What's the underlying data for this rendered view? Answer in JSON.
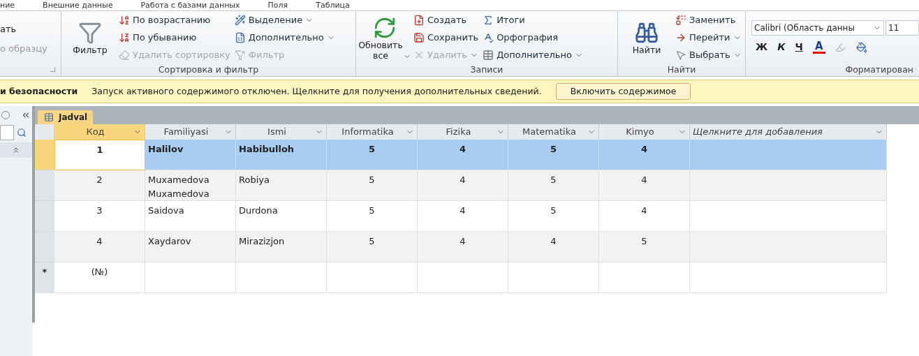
{
  "ribbon_tabs": [
    {
      "label": "ние"
    },
    {
      "label": "Внешние данные"
    },
    {
      "label": "Работа с базами данных"
    },
    {
      "label": "Поля"
    },
    {
      "label": "Таблица"
    }
  ],
  "clipboard_partial": {
    "items": [
      "ать",
      "о образцу"
    ]
  },
  "groups": [
    {
      "label": "Сортировка и фильтр",
      "large": {
        "label": "Фильтр",
        "dropdown": false
      },
      "columns": [
        [
          {
            "label": "По возрастанию",
            "disabled": false,
            "dropdown": false
          },
          {
            "label": "По убыванию",
            "disabled": false,
            "dropdown": false
          },
          {
            "label": "Удалить сортировку",
            "disabled": true,
            "dropdown": false
          }
        ],
        [
          {
            "label": "Выделение",
            "disabled": false,
            "dropdown": true
          },
          {
            "label": "Дополнительно",
            "disabled": false,
            "dropdown": true
          },
          {
            "label": "Фильтр",
            "disabled": true,
            "dropdown": false
          }
        ]
      ]
    },
    {
      "label": "Записи",
      "large": {
        "label": "Обновить все",
        "dropdown": true
      },
      "columns": [
        [
          {
            "label": "Создать",
            "disabled": false,
            "dropdown": false
          },
          {
            "label": "Сохранить",
            "disabled": false,
            "dropdown": false
          },
          {
            "label": "Удалить",
            "disabled": true,
            "dropdown": true
          }
        ],
        [
          {
            "label": "Итоги",
            "disabled": false,
            "dropdown": false
          },
          {
            "label": "Орфография",
            "disabled": false,
            "dropdown": false
          },
          {
            "label": "Дополнительно",
            "disabled": false,
            "dropdown": true
          }
        ]
      ]
    },
    {
      "label": "Найти",
      "large": {
        "label": "Найти",
        "dropdown": false
      },
      "columns": [
        [
          {
            "label": "Заменить",
            "disabled": false,
            "dropdown": false
          },
          {
            "label": "Перейти",
            "disabled": false,
            "dropdown": true
          },
          {
            "label": "Выбрать",
            "disabled": false,
            "dropdown": true
          }
        ]
      ]
    }
  ],
  "formatting": {
    "label": "Форматирован",
    "font": "Calibri (Область данны",
    "size": "11",
    "styles": [
      "Ж",
      "К",
      "Ч"
    ],
    "font_color": "A"
  },
  "security_bar": {
    "title": "и безопасности",
    "message": "Запуск активного содержимого отключен. Щелкните для получения дополнительных сведений.",
    "button": "Включить содержимое"
  },
  "document_tab": {
    "label": "Jadval",
    "selected": true
  },
  "table": {
    "columns": [
      {
        "label": "Код",
        "italic": false
      },
      {
        "label": "Familiyasi",
        "italic": false
      },
      {
        "label": "Ismi",
        "italic": false
      },
      {
        "label": "Informatika",
        "italic": false
      },
      {
        "label": "Fizika",
        "italic": false
      },
      {
        "label": "Matematika",
        "italic": false
      },
      {
        "label": "Kimyo",
        "italic": false
      },
      {
        "label": "Щелкните для добавления",
        "italic": true
      }
    ],
    "rows": [
      {
        "selected": true,
        "cells": [
          "1",
          "Halilov",
          "Habibulloh",
          "5",
          "4",
          "5",
          "4",
          ""
        ]
      },
      {
        "selected": false,
        "cells": [
          "2",
          "Muxamedova Muxamedova",
          "Robiya",
          "5",
          "4",
          "5",
          "4",
          ""
        ]
      },
      {
        "selected": false,
        "cells": [
          "3",
          "Saidova",
          "Durdona",
          "5",
          "4",
          "5",
          "4",
          ""
        ]
      },
      {
        "selected": false,
        "cells": [
          "4",
          "Xaydarov",
          "Mirazizjon",
          "5",
          "4",
          "4",
          "5",
          ""
        ]
      }
    ],
    "new_row": {
      "marker": "*",
      "cells": [
        "(№)"
      ]
    }
  }
}
